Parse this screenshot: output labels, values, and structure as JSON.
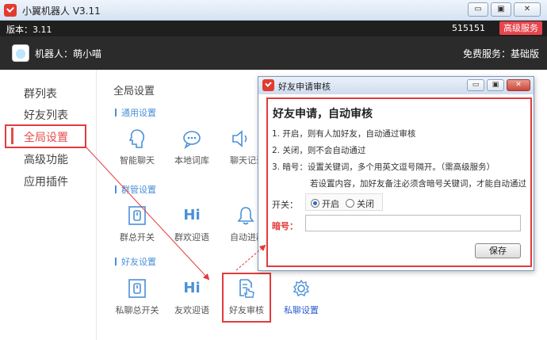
{
  "app": {
    "title": "小翼机器人 V3.11",
    "minimize_label": "▭",
    "restore_label": "▣",
    "close_label": "✕"
  },
  "infobar": {
    "version": "版本：3.11",
    "user_id": "515151",
    "premium_button": "高级服务"
  },
  "robotbar": {
    "robot_name": "机器人：萌小喵",
    "service": "免费服务：基础版"
  },
  "sidebar": {
    "items": [
      {
        "label": "群列表"
      },
      {
        "label": "好友列表"
      },
      {
        "label": "全局设置"
      },
      {
        "label": "高级功能"
      },
      {
        "label": "应用插件"
      }
    ],
    "active_index": 2
  },
  "content": {
    "title": "全局设置",
    "sections": [
      {
        "heading": "通用设置",
        "tiles": [
          {
            "label": "智能聊天",
            "icon": "smart-chat-icon"
          },
          {
            "label": "本地词库",
            "icon": "local-dictionary-icon"
          },
          {
            "label": "聊天记录",
            "icon": "chat-record-icon"
          }
        ]
      },
      {
        "heading": "群管设置",
        "tiles": [
          {
            "label": "群总开关",
            "icon": "group-master-switch-icon"
          },
          {
            "label": "群欢迎语",
            "icon": "group-welcome-icon"
          },
          {
            "label": "自动进群",
            "icon": "auto-join-group-icon"
          }
        ]
      },
      {
        "heading": "好友设置",
        "tiles": [
          {
            "label": "私聊总开关",
            "icon": "private-chat-switch-icon"
          },
          {
            "label": "友欢迎语",
            "icon": "friend-welcome-icon"
          },
          {
            "label": "好友审核",
            "icon": "friend-review-icon"
          },
          {
            "label": "私聊设置",
            "icon": "gear-icon"
          }
        ]
      }
    ],
    "hi_glyph": "Hi"
  },
  "dialog": {
    "title": "好友申请审核",
    "heading": "好友申请，自动审核",
    "rules": [
      "1. 开启，则有人加好友，自动通过审核",
      "2. 关闭，则不会自动通过",
      "3. 暗号：设置关键词，多个用英文逗号隔开。（需高级服务）",
      "若设置内容，加好友备注必须含暗号关键词，才能自动通过"
    ],
    "switch_label": "开关：",
    "option_on": "开启",
    "option_off": "关闭",
    "selected": "开启",
    "code_label": "暗号：",
    "code_value": "",
    "save_button": "保存"
  },
  "colors": {
    "accent_red": "#e23b3b",
    "link_blue": "#4a90d9",
    "dark_bar": "#1f1f1f"
  }
}
